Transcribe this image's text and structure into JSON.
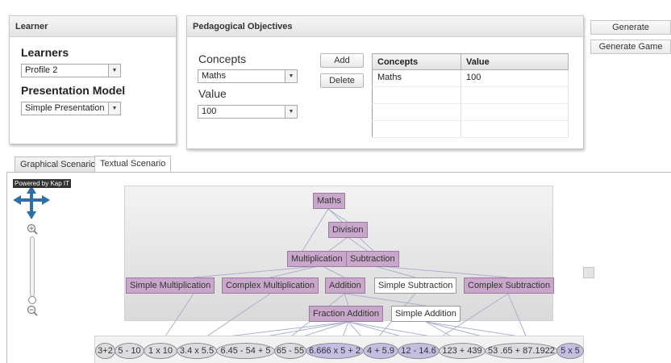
{
  "learner_panel": {
    "header": "Learner",
    "learners_label": "Learners",
    "profile_value": "Profile 2",
    "presentation_label": "Presentation Model",
    "presentation_value": "Simple Presentation"
  },
  "objectives_panel": {
    "header": "Pedagogical Objectives",
    "concepts_label": "Concepts",
    "concepts_value": "Maths",
    "value_label": "Value",
    "value_value": "100",
    "add_label": "Add",
    "delete_label": "Delete",
    "table": {
      "columns": [
        "Concepts",
        "Value"
      ],
      "rows": [
        [
          "Maths",
          "100"
        ],
        [
          "",
          ""
        ],
        [
          "",
          ""
        ],
        [
          "",
          ""
        ]
      ]
    }
  },
  "actions": {
    "generate": "Generate",
    "generate_game": "Generate Game"
  },
  "tabs": {
    "graphical": "Graphical Scenario",
    "textual": "Textual Scenario"
  },
  "tooltip": "Powered by Kap IT",
  "graph": {
    "nodes": [
      "Maths",
      "Division",
      "Multiplication",
      "Subtraction",
      "Simple Multiplication",
      "Complex Multiplication",
      "Addition",
      "Simple Subtraction",
      "Complex Subtraction",
      "Fraction Addition",
      "Simple Addition"
    ]
  },
  "sequence": [
    "3+2",
    "5 - 10",
    "1 x 10",
    "3.4 x 5.5",
    "6.45 - 54 + 5",
    "65 - 55",
    "6.666 x 5 + 2",
    "4 + 5.9",
    "12 - 14.6",
    "123 + 439",
    "53 .65 + 87.1922",
    "5 x 5"
  ],
  "colors": {
    "node_fill": "#c9a7cb",
    "node_border": "#9c7aa0",
    "sequence_highlight": "#c3bee2",
    "nav_arrow": "#2e6fa7"
  },
  "icons": {
    "pan": "pan-arrows-icon",
    "zoom_in": "zoom-in-icon",
    "zoom_out": "zoom-out-icon",
    "collapsed": "collapsed-node-icon"
  }
}
